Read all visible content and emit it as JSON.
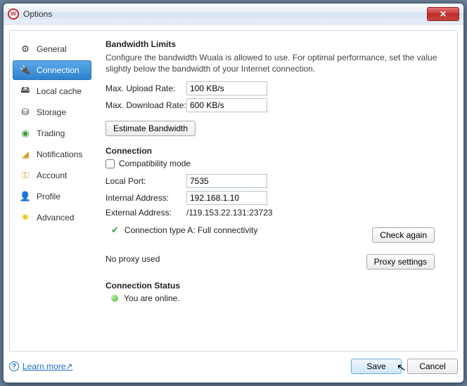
{
  "window": {
    "title": "Options"
  },
  "sidebar": {
    "items": [
      {
        "label": "General",
        "icon": "gear-icon"
      },
      {
        "label": "Connection",
        "icon": "plug-icon",
        "active": true
      },
      {
        "label": "Local cache",
        "icon": "disk-icon"
      },
      {
        "label": "Storage",
        "icon": "drive-icon"
      },
      {
        "label": "Trading",
        "icon": "globe-icon"
      },
      {
        "label": "Notifications",
        "icon": "bell-icon"
      },
      {
        "label": "Account",
        "icon": "key-icon"
      },
      {
        "label": "Profile",
        "icon": "person-icon"
      },
      {
        "label": "Advanced",
        "icon": "star-icon"
      }
    ]
  },
  "bandwidth": {
    "title": "Bandwidth Limits",
    "description": "Configure the bandwidth Wuala is allowed to use. For optimal performance, set the value slightly below the bandwidth of your Internet connection.",
    "upload_label": "Max. Upload Rate:",
    "upload_value": "100 KB/s",
    "download_label": "Max. Download Rate:",
    "download_value": "600 KB/s",
    "estimate_label": "Estimate Bandwidth"
  },
  "connection": {
    "title": "Connection",
    "compat_label": "Compatibility mode",
    "compat_checked": false,
    "port_label": "Local Port:",
    "port_value": "7535",
    "internal_label": "Internal Address:",
    "internal_value": "192.168.1.10",
    "external_label": "External Address:",
    "external_value": "/119.153.22.131:23723",
    "type_text": "Connection type A: Full connectivity",
    "check_label": "Check again",
    "proxy_text": "No proxy used",
    "proxy_btn": "Proxy settings"
  },
  "status": {
    "title": "Connection Status",
    "text": "You are online."
  },
  "footer": {
    "learn": "Learn more↗",
    "save": "Save",
    "cancel": "Cancel"
  }
}
